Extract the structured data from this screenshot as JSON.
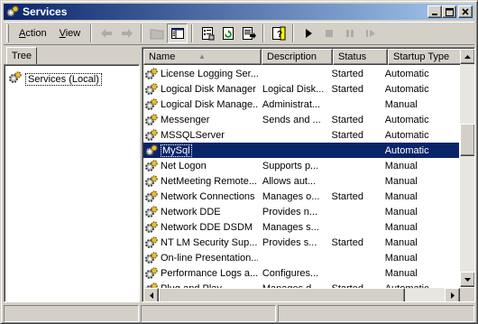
{
  "window": {
    "title": "Services"
  },
  "menu": {
    "action": "Action",
    "view": "View"
  },
  "toolbar": {
    "buttons": [
      {
        "name": "back-arrow-icon",
        "state": "disabled"
      },
      {
        "name": "forward-arrow-icon",
        "state": "disabled"
      },
      {
        "name": "up-folder-icon",
        "state": "disabled"
      },
      {
        "name": "show-hide-tree-icon",
        "state": "pressed"
      },
      {
        "name": "properties-icon",
        "state": "normal"
      },
      {
        "name": "refresh-icon",
        "state": "normal"
      },
      {
        "name": "export-list-icon",
        "state": "normal"
      },
      {
        "name": "help-icon",
        "state": "normal"
      },
      {
        "name": "start-service-icon",
        "state": "normal"
      },
      {
        "name": "stop-service-icon",
        "state": "disabled"
      },
      {
        "name": "pause-service-icon",
        "state": "disabled"
      },
      {
        "name": "restart-service-icon",
        "state": "disabled"
      }
    ]
  },
  "tree": {
    "tab_label": "Tree",
    "root_label": "Services (Local)"
  },
  "columns": [
    "Name",
    "Description",
    "Status",
    "Startup Type"
  ],
  "sort_indicator": "▲",
  "services": [
    {
      "name": "License Logging Ser...",
      "description": "",
      "status": "Started",
      "startup": "Automatic",
      "selected": false
    },
    {
      "name": "Logical Disk Manager",
      "description": "Logical Disk...",
      "status": "Started",
      "startup": "Automatic",
      "selected": false
    },
    {
      "name": "Logical Disk Manage...",
      "description": "Administrat...",
      "status": "",
      "startup": "Manual",
      "selected": false
    },
    {
      "name": "Messenger",
      "description": "Sends and ...",
      "status": "Started",
      "startup": "Automatic",
      "selected": false
    },
    {
      "name": "MSSQLServer",
      "description": "",
      "status": "Started",
      "startup": "Automatic",
      "selected": false
    },
    {
      "name": "MySql",
      "description": "",
      "status": "",
      "startup": "Automatic",
      "selected": true
    },
    {
      "name": "Net Logon",
      "description": "Supports p...",
      "status": "",
      "startup": "Manual",
      "selected": false
    },
    {
      "name": "NetMeeting Remote...",
      "description": "Allows aut...",
      "status": "",
      "startup": "Manual",
      "selected": false
    },
    {
      "name": "Network Connections",
      "description": "Manages o...",
      "status": "Started",
      "startup": "Manual",
      "selected": false
    },
    {
      "name": "Network DDE",
      "description": "Provides n...",
      "status": "",
      "startup": "Manual",
      "selected": false
    },
    {
      "name": "Network DDE DSDM",
      "description": "Manages s...",
      "status": "",
      "startup": "Manual",
      "selected": false
    },
    {
      "name": "NT LM Security Sup...",
      "description": "Provides s...",
      "status": "Started",
      "startup": "Manual",
      "selected": false
    },
    {
      "name": "On-line Presentation...",
      "description": "",
      "status": "",
      "startup": "Manual",
      "selected": false
    },
    {
      "name": "Performance Logs a...",
      "description": "Configures...",
      "status": "",
      "startup": "Manual",
      "selected": false
    },
    {
      "name": "Plug and Play",
      "description": "Manages d...",
      "status": "Started",
      "startup": "Automatic",
      "selected": false
    }
  ],
  "colors": {
    "selection": "#0a246a",
    "title_start": "#0a246a",
    "title_end": "#a6caf0"
  }
}
